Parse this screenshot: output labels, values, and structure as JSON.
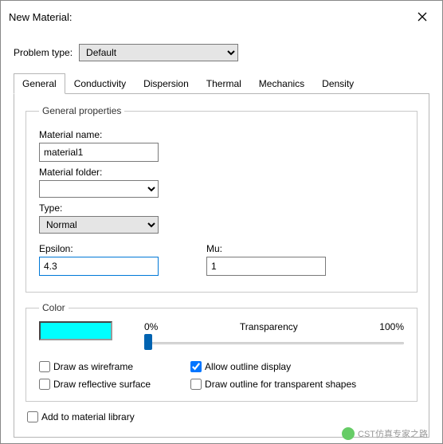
{
  "title": "New Material:",
  "problem": {
    "label": "Problem type:",
    "value": "Default"
  },
  "tabs": [
    "General",
    "Conductivity",
    "Dispersion",
    "Thermal",
    "Mechanics",
    "Density"
  ],
  "gp": {
    "legend": "General properties",
    "name_lbl": "Material name:",
    "name": "material1",
    "folder_lbl": "Material folder:",
    "folder": "",
    "type_lbl": "Type:",
    "type": "Normal",
    "eps_lbl": "Epsilon:",
    "eps": "4.3",
    "mu_lbl": "Mu:",
    "mu": "1"
  },
  "color": {
    "legend": "Color",
    "t0": "0%",
    "t1": "Transparency",
    "t2": "100%",
    "wire": "Draw as wireframe",
    "refl": "Draw reflective surface",
    "outl": "Allow outline display",
    "outt": "Draw outline for transparent shapes"
  },
  "lib": "Add to material library",
  "watermark": "CST仿真专家之路"
}
